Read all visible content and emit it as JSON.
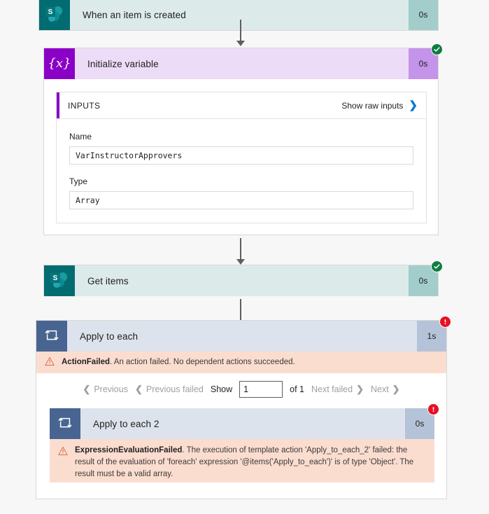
{
  "flow": {
    "nodes": [
      {
        "id": "trigger",
        "title": "When an item is created",
        "duration": "0s",
        "connector": "sharepoint",
        "status": null
      },
      {
        "id": "init-var",
        "title": "Initialize variable",
        "duration": "0s",
        "connector": "variable",
        "status": "succeeded"
      },
      {
        "id": "get-items",
        "title": "Get items",
        "duration": "0s",
        "connector": "sharepoint",
        "status": "succeeded"
      },
      {
        "id": "apply-to-each",
        "title": "Apply to each",
        "duration": "1s",
        "connector": "control",
        "status": "failed"
      },
      {
        "id": "apply-to-each-2",
        "title": "Apply to each 2",
        "duration": "0s",
        "connector": "control",
        "status": "failed"
      }
    ]
  },
  "inputs_panel": {
    "heading": "INPUTS",
    "show_raw_label": "Show raw inputs",
    "show_raw_chevron": "❯",
    "fields": [
      {
        "label": "Name",
        "value": "VarInstructorApprovers"
      },
      {
        "label": "Type",
        "value": "Array"
      }
    ]
  },
  "errors": {
    "apply_to_each": {
      "code": "ActionFailed",
      "message": ". An action failed. No dependent actions succeeded."
    },
    "apply_to_each_2": {
      "code": "ExpressionEvaluationFailed",
      "message": ". The execution of template action 'Apply_to_each_2' failed: the result of the evaluation of 'foreach' expression '@items('Apply_to_each')' is of type 'Object'. The result must be a valid array."
    }
  },
  "pagination": {
    "previous": "Previous",
    "previous_failed": "Previous failed",
    "show_label": "Show",
    "show_value": "1",
    "of_label": "of 1",
    "next_failed": "Next failed",
    "next": "Next",
    "prev_chevron": "❮",
    "next_chevron": "❯"
  },
  "colors": {
    "sharepoint_icon": "#036c70",
    "sharepoint_body": "#dcebea",
    "sharepoint_duration": "#a3cdcb",
    "variable_icon": "#8b00c7",
    "variable_body": "#eddcf7",
    "variable_duration": "#c493ea",
    "control_icon": "#486591",
    "control_body": "#dde3ec",
    "control_duration": "#b5c3d8",
    "error_background": "#fbddd0",
    "error_badge": "#e81123",
    "success_badge": "#107c41",
    "link_blue": "#0078d4",
    "page_background": "#f7f7f7"
  }
}
